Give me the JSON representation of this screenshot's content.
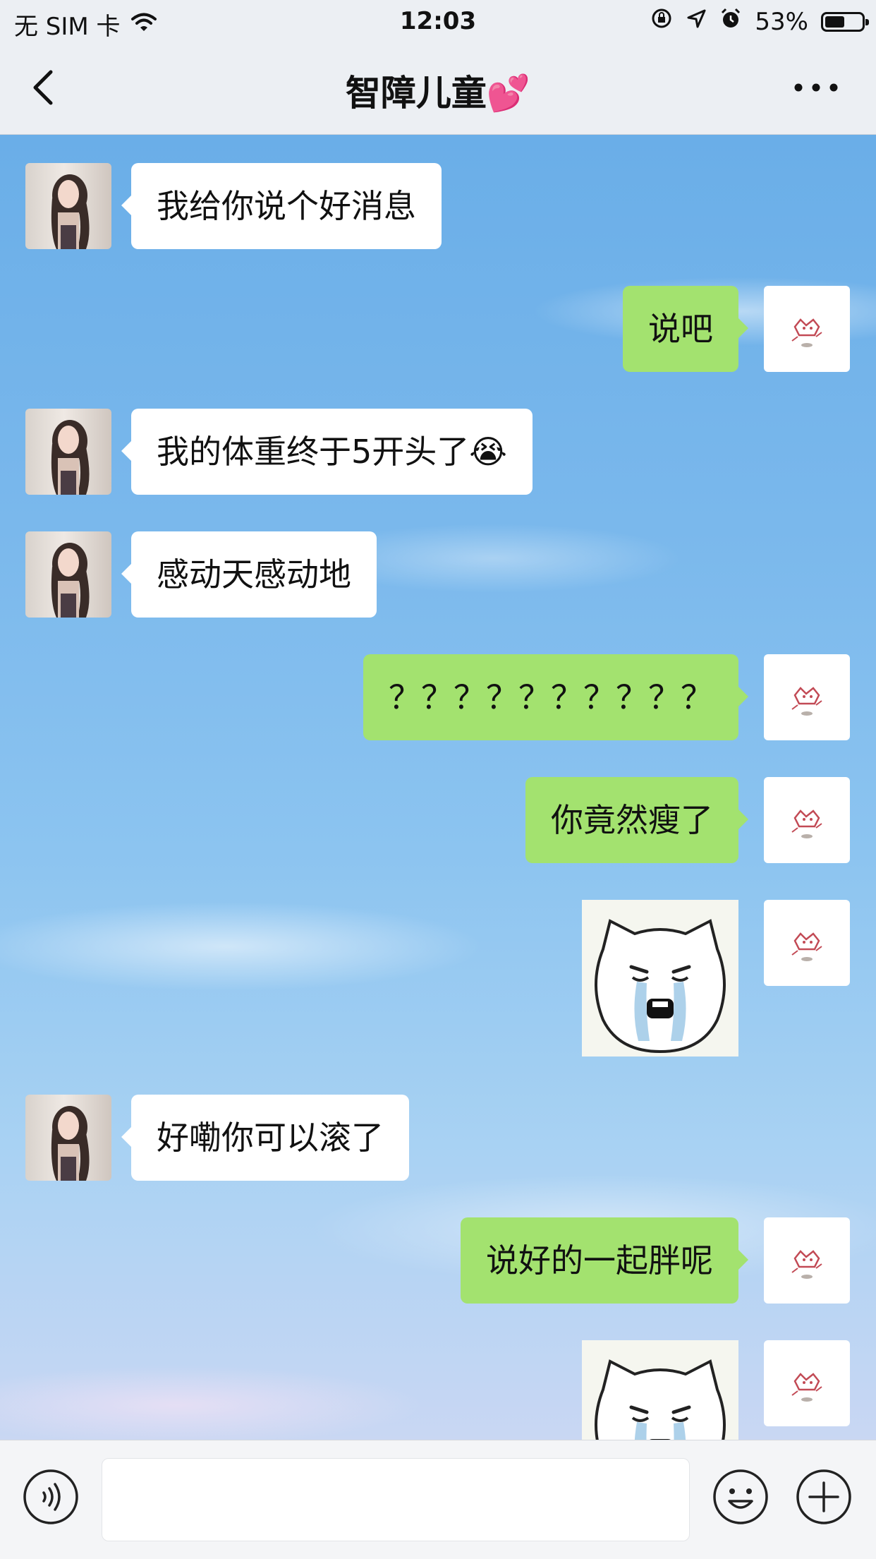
{
  "status_bar": {
    "carrier": "无 SIM 卡",
    "time": "12:03",
    "battery": "53%",
    "battery_level": 0.53,
    "icons": [
      "wifi-icon",
      "orientation-lock-icon",
      "location-icon",
      "alarm-icon",
      "battery-icon"
    ]
  },
  "nav": {
    "title": "智障儿童",
    "title_emoji": "💕",
    "back_icon": "chevron-left-icon",
    "more_icon": "more-dots-icon"
  },
  "chat": {
    "messages": [
      {
        "from": "them",
        "type": "text",
        "text": "我给你说个好消息"
      },
      {
        "from": "me",
        "type": "text",
        "text": "说吧"
      },
      {
        "from": "them",
        "type": "text",
        "text": "我的体重终于5开头了😭"
      },
      {
        "from": "them",
        "type": "text",
        "text": "感动天感动地"
      },
      {
        "from": "me",
        "type": "text",
        "text": "？？？？？？？？？？"
      },
      {
        "from": "me",
        "type": "text",
        "text": "你竟然瘦了"
      },
      {
        "from": "me",
        "type": "sticker",
        "sticker": "crying-bear-sticker"
      },
      {
        "from": "them",
        "type": "text",
        "text": "好嘞你可以滚了"
      },
      {
        "from": "me",
        "type": "text",
        "text": "说好的一起胖呢"
      },
      {
        "from": "me",
        "type": "sticker",
        "sticker": "crying-bear-sticker"
      }
    ]
  },
  "input_bar": {
    "value": "",
    "icons": [
      "voice-icon",
      "emoji-icon",
      "plus-icon"
    ]
  },
  "colors": {
    "my_bubble": "#a3e26f",
    "their_bubble": "#ffffff",
    "bar_background": "#eceff3"
  }
}
